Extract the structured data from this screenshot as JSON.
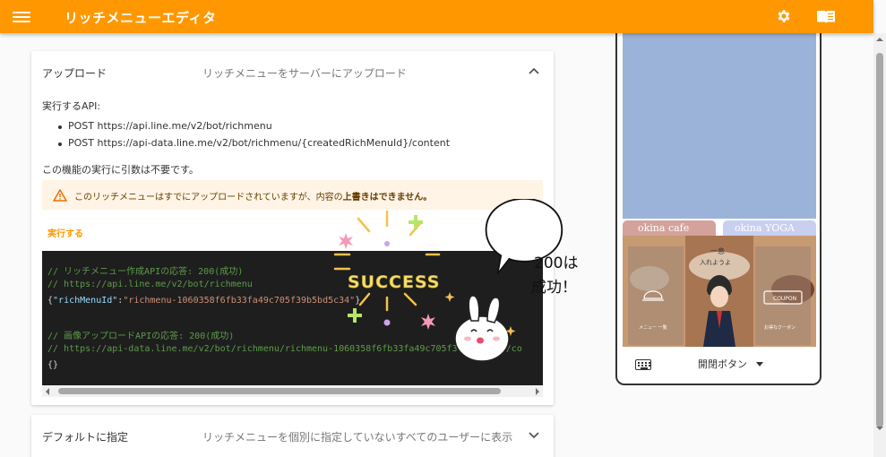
{
  "app": {
    "title": "リッチメニューエディタ",
    "accent_color": "#ff9800",
    "icons": [
      "menu-icon",
      "gear-icon",
      "book-icon"
    ]
  },
  "upload_panel": {
    "title": "アップロード",
    "description": "リッチメニューをサーバーにアップロード",
    "api_label": "実行するAPI:",
    "api_items": [
      "POST https://api.line.me/v2/bot/richmenu",
      "POST https://api-data.line.me/v2/bot/richmenu/{createdRichMenuId}/content"
    ],
    "no_args_text": "この機能の実行に引数は不要です。",
    "warning_before": "このリッチメニューはすでにアップロードされていますが、内容の",
    "warning_bold": "上書きはできません。",
    "run_button": "実行する",
    "code": {
      "comment1": "// リッチメニュー作成APIの応答: 200(成功)",
      "url1": "// https://api.line.me/v2/bot/richmenu",
      "json_open": "{",
      "json_key": "\"richMenuId\"",
      "json_colon": ":",
      "json_value": "\"richmenu-1060358f6fb33fa49c705f39b5bd5c34\"",
      "json_close": "}",
      "comment2": "// 画像アップロードAPIの応答: 200(成功)",
      "url2": "// https://api-data.line.me/v2/bot/richmenu/richmenu-1060358f6fb33fa49c705f39b5bd5c34/co",
      "empty_obj": "{}"
    }
  },
  "default_panel": {
    "title": "デフォルトに指定",
    "description": "リッチメニューを個別に指定していないすべてのユーザーに表示"
  },
  "overlay": {
    "success_text": "SUCCESS",
    "bubble_line1": "200は",
    "bubble_line2": "成功！"
  },
  "phone": {
    "tab1": "okina cafe",
    "tab2": "okina YOGA",
    "menu_label_left": "メニュー 一覧",
    "menu_label_right": "お得なクーポン",
    "coupon_text": "COUPON",
    "welcome_text_1": "一息",
    "welcome_text_2": "入れようよ",
    "toggle_label": "開閉ボタン"
  }
}
